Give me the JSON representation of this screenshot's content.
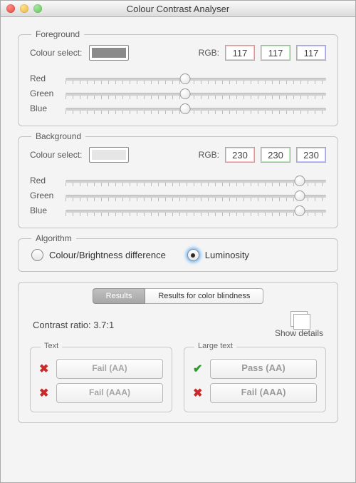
{
  "window": {
    "title": "Colour Contrast Analyser"
  },
  "foreground": {
    "label": "Foreground",
    "colour_select_label": "Colour select:",
    "swatch_hex": "#8a8a8a",
    "rgb_label": "RGB:",
    "r": "117",
    "g": "117",
    "b": "117",
    "slider_labels": {
      "r": "Red",
      "g": "Green",
      "b": "Blue"
    },
    "slider_pct": 46
  },
  "background": {
    "label": "Background",
    "colour_select_label": "Colour select:",
    "swatch_hex": "#e6e6e6",
    "rgb_label": "RGB:",
    "r": "230",
    "g": "230",
    "b": "230",
    "slider_labels": {
      "r": "Red",
      "g": "Green",
      "b": "Blue"
    },
    "slider_pct": 90
  },
  "algorithm": {
    "label": "Algorithm",
    "option1": "Colour/Brightness difference",
    "option2": "Luminosity",
    "selected": "option2"
  },
  "results": {
    "tabs": {
      "results": "Results",
      "blindness": "Results for color blindness"
    },
    "active_tab": "results",
    "ratio_label": "Contrast ratio: 3.7:1",
    "details_label": "Show details",
    "text": {
      "label": "Text",
      "aa": {
        "pass": false,
        "label": "Fail (AA)"
      },
      "aaa": {
        "pass": false,
        "label": "Fail (AAA)"
      }
    },
    "large": {
      "label": "Large text",
      "aa": {
        "pass": true,
        "label": "Pass (AA)"
      },
      "aaa": {
        "pass": false,
        "label": "Fail (AAA)"
      }
    }
  }
}
